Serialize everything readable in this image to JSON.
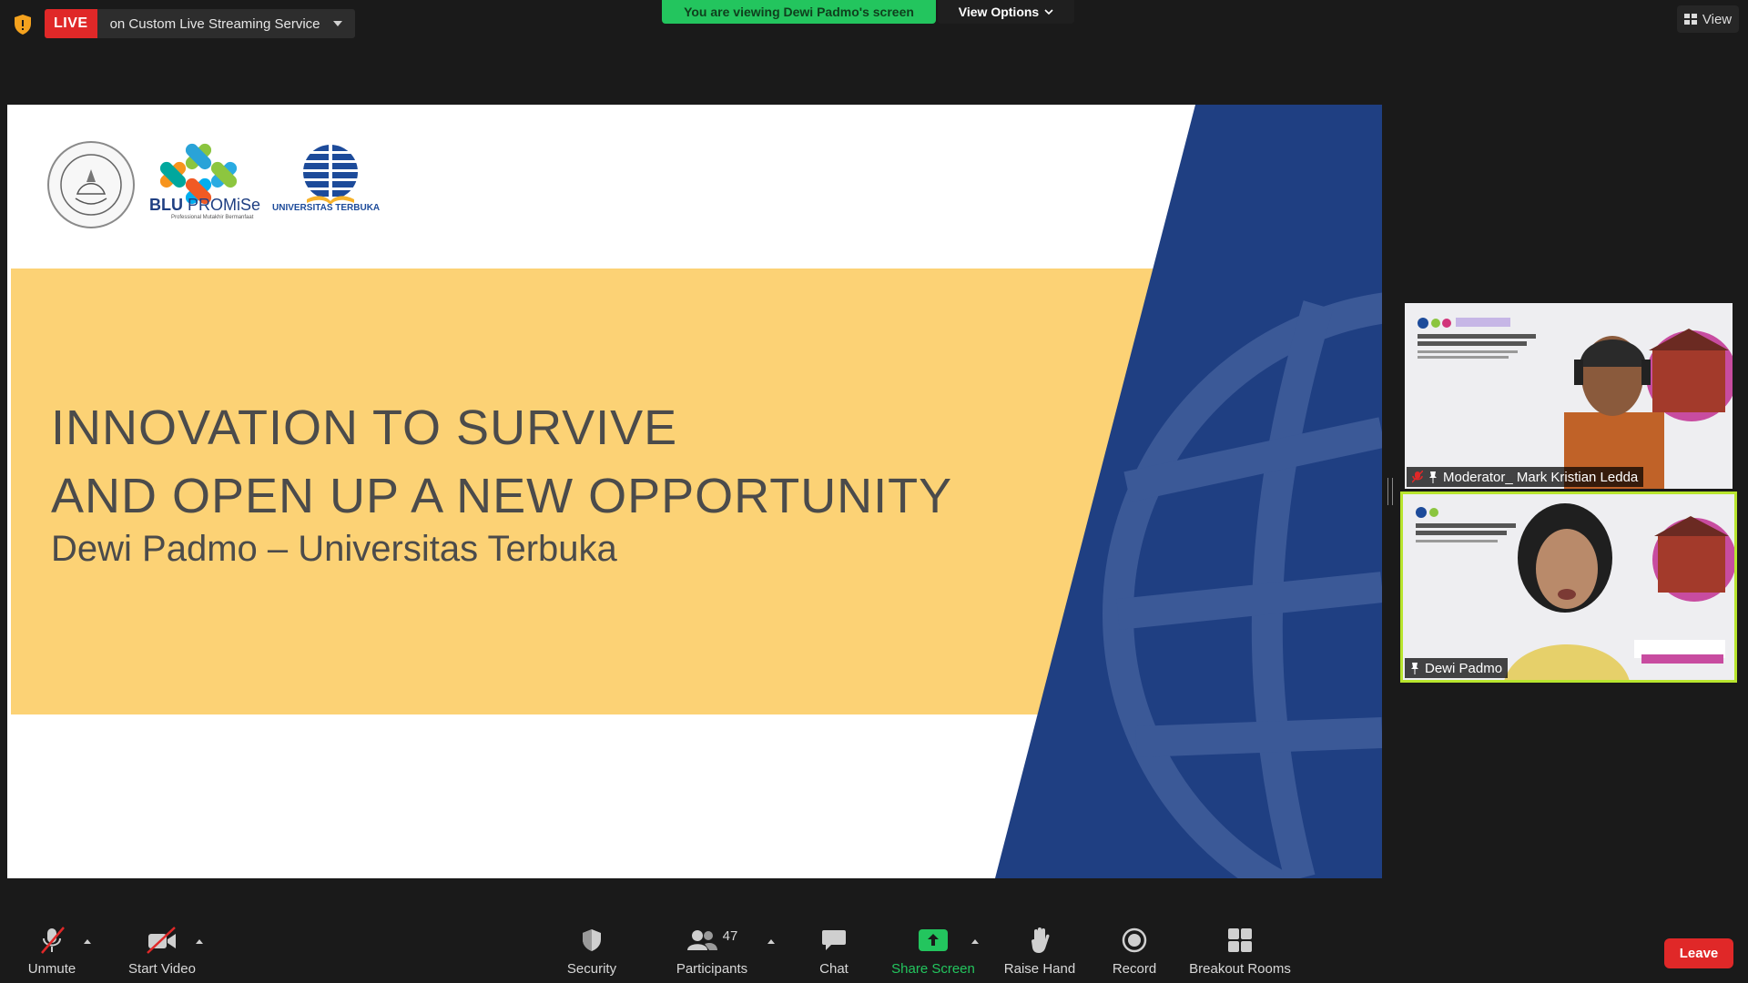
{
  "topbar": {
    "live_label": "LIVE",
    "live_service": "on Custom Live Streaming Service",
    "viewing_banner": "You are viewing Dewi Padmo's screen",
    "view_options": "View Options",
    "view_button": "View"
  },
  "slide": {
    "title_line1": "INNOVATION TO SURVIVE",
    "title_line2": "AND OPEN UP A NEW OPPORTUNITY",
    "subtitle": "Dewi Padmo – Universitas Terbuka",
    "logo_blu_bold": "BLU",
    "logo_blu_rest": " PROMiSe",
    "logo_blu_tagline": "Professional Mutakhir Bermanfaat",
    "logo_ut": "UNIVERSITAS TERBUKA",
    "logo_tut": "TUT WURI HANDAYANI",
    "colors": {
      "band": "#fcd275",
      "navy": "#1f3f82"
    }
  },
  "participants_panel": {
    "tiles": [
      {
        "name": "Moderator_ Mark Kristian Ledda",
        "muted": true
      },
      {
        "name": "Dewi Padmo",
        "muted": false,
        "active_speaker": true
      }
    ]
  },
  "toolbar": {
    "unmute": "Unmute",
    "start_video": "Start Video",
    "security": "Security",
    "participants": "Participants",
    "participants_count": "47",
    "chat": "Chat",
    "share_screen": "Share Screen",
    "raise_hand": "Raise Hand",
    "record": "Record",
    "breakout_rooms": "Breakout Rooms",
    "leave": "Leave",
    "accent_green": "#23c55e",
    "danger_red": "#e02828"
  }
}
